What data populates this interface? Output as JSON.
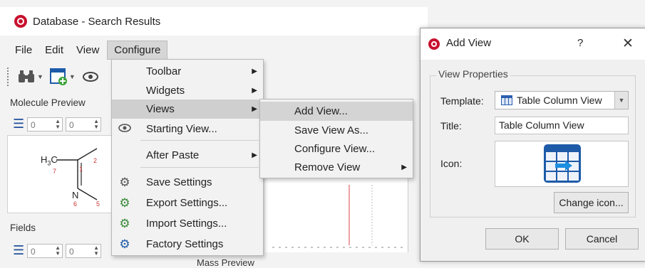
{
  "window": {
    "title": "Database - Search Results"
  },
  "menubar": {
    "items": [
      "File",
      "Edit",
      "View",
      "Configure"
    ]
  },
  "panels": {
    "molecule_preview": "Molecule Preview",
    "fields": "Fields",
    "mass_preview": "Mass Preview",
    "spin_value": "0"
  },
  "molecule": {
    "h3c": "H",
    "h3c_sub": "3",
    "h3c_c": "C",
    "n": "N",
    "num7": "7",
    "num1": "1",
    "num2": "2",
    "num6": "6",
    "num5": "5"
  },
  "configure_menu": {
    "items": [
      {
        "label": "Toolbar",
        "icon": "",
        "submenu": true
      },
      {
        "label": "Widgets",
        "icon": "",
        "submenu": true
      },
      {
        "label": "Views",
        "icon": "",
        "submenu": true
      },
      {
        "label": "Starting View...",
        "icon": "eye-icon",
        "submenu": false
      },
      {
        "label": "After Paste",
        "icon": "",
        "submenu": true
      },
      {
        "label": "Save Settings",
        "icon": "gear-save-icon",
        "submenu": false
      },
      {
        "label": "Export Settings...",
        "icon": "gear-export-icon",
        "submenu": false
      },
      {
        "label": "Import Settings...",
        "icon": "gear-import-icon",
        "submenu": false
      },
      {
        "label": "Factory Settings",
        "icon": "gear-reset-icon",
        "submenu": false
      }
    ]
  },
  "views_submenu": {
    "items": [
      "Add View...",
      "Save View As...",
      "Configure View...",
      "Remove View"
    ]
  },
  "dialog": {
    "title": "Add View",
    "help": "?",
    "close": "✕",
    "group_label": "View Properties",
    "template_label": "Template:",
    "template_value": "Table Column View",
    "title_label": "Title:",
    "title_value": "Table Column View",
    "icon_label": "Icon:",
    "change_icon": "Change icon...",
    "ok": "OK",
    "cancel": "Cancel"
  },
  "colors": {
    "accent": "#1d5aa8",
    "logo": "#c8102e",
    "highlight": "#cfcfcf"
  }
}
